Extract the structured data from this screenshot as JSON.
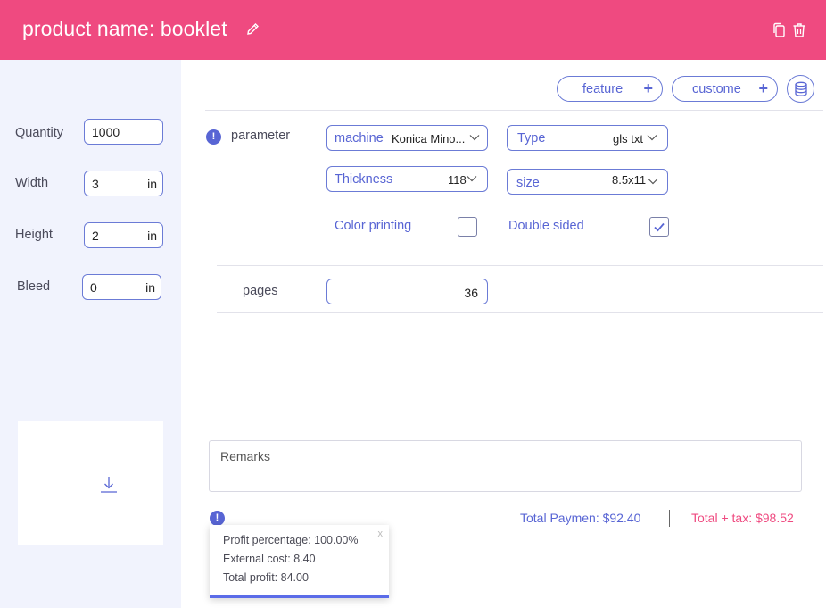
{
  "header": {
    "title": "product name: booklet",
    "bg_color": "#ef4a80",
    "icons": [
      "pencil-icon",
      "copy-icon",
      "trash-icon"
    ]
  },
  "sidebar": {
    "quantity": {
      "label": "Quantity",
      "value": "1000"
    },
    "width": {
      "label": "Width",
      "value": "3",
      "unit": "in"
    },
    "height": {
      "label": "Height",
      "value": "2",
      "unit": "in"
    },
    "bleed": {
      "label": "Bleed",
      "value": "0",
      "unit": "in"
    },
    "download_icon": "download-icon"
  },
  "toolbar": {
    "feature_label": "feature",
    "custome_label": "custome",
    "plus": "+",
    "database_icon": "database-icon"
  },
  "parameter": {
    "label": "parameter",
    "info": "!",
    "machine": {
      "key": "machine",
      "value": "Konica Mino..."
    },
    "type": {
      "key": "Type",
      "value": "gls txt"
    },
    "thickness": {
      "key": "Thickness",
      "value": "118"
    },
    "size": {
      "key": "size",
      "value": "8.5x11"
    },
    "color_printing": {
      "label": "Color printing",
      "checked": false
    },
    "double_sided": {
      "label": "Double sided",
      "checked": true
    }
  },
  "pages": {
    "label": "pages",
    "value": "36"
  },
  "remarks": {
    "label": "Remarks"
  },
  "totals": {
    "info": "!",
    "total_payment": "Total Paymen: $92.40",
    "total_tax": "Total  + tax: $98.52"
  },
  "tooltip": {
    "profit_percentage": "Profit percentage: 100.00%",
    "external_cost": "External cost: 8.40",
    "total_profit": "Total profit: 84.00",
    "close": "x"
  },
  "colors": {
    "accent": "#5865d4",
    "pink": "#ef4a80",
    "sidebar_bg": "#f1f3fd"
  }
}
